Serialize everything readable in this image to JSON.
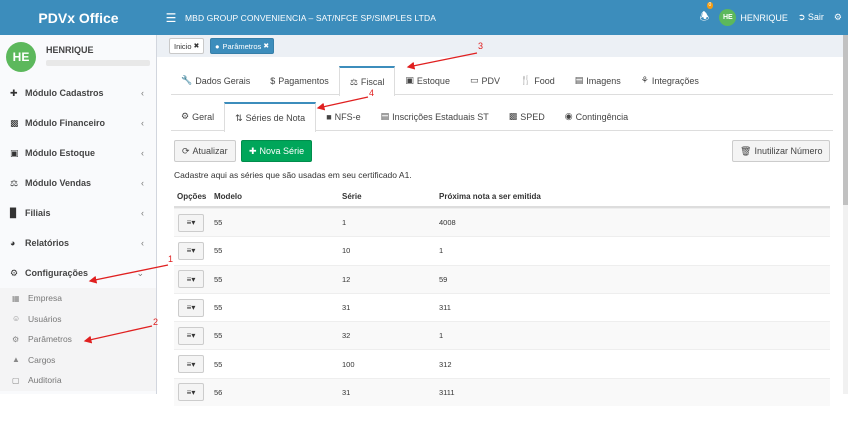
{
  "app": {
    "brand": "PDVx Office"
  },
  "header": {
    "company": "MBD GROUP CONVENIENCIA – SAT/NFCE SP/SIMPLES LTDA",
    "notification_count": "0",
    "avatar_initials": "HE",
    "user_name": "HENRIQUE",
    "logout_label": "Sair"
  },
  "sidebar": {
    "avatar_initials": "HE",
    "user_name": "HENRIQUE",
    "items": [
      {
        "label": "Módulo Cadastros",
        "icon": "plus-icon"
      },
      {
        "label": "Módulo Financeiro",
        "icon": "money-icon"
      },
      {
        "label": "Módulo Estoque",
        "icon": "box-icon"
      },
      {
        "label": "Módulo Vendas",
        "icon": "balance-icon"
      },
      {
        "label": "Filiais",
        "icon": "bar-chart-icon"
      },
      {
        "label": "Relatórios",
        "icon": "pie-chart-icon"
      },
      {
        "label": "Configurações",
        "icon": "gears-icon"
      }
    ],
    "subitems": [
      {
        "label": "Empresa",
        "icon": "building-icon"
      },
      {
        "label": "Usuários",
        "icon": "user-icon"
      },
      {
        "label": "Parâmetros",
        "icon": "gear-icon"
      },
      {
        "label": "Cargos",
        "icon": "sitemap-icon"
      },
      {
        "label": "Auditoria",
        "icon": "audit-icon"
      }
    ]
  },
  "breadcrumbs": [
    {
      "label": "Inicio"
    },
    {
      "label": "Parâmetros"
    }
  ],
  "main_tabs": [
    {
      "label": "Dados Gerais"
    },
    {
      "label": "Pagamentos"
    },
    {
      "label": "Fiscal"
    },
    {
      "label": "Estoque"
    },
    {
      "label": "PDV"
    },
    {
      "label": "Food"
    },
    {
      "label": "Imagens"
    },
    {
      "label": "Integrações"
    }
  ],
  "fiscal_tabs": [
    {
      "label": "Geral"
    },
    {
      "label": "Séries de Nota"
    },
    {
      "label": "NFS-e"
    },
    {
      "label": "Inscrições Estaduais ST"
    },
    {
      "label": "SPED"
    },
    {
      "label": "Contingência"
    }
  ],
  "toolbar": {
    "refresh_label": "Atualizar",
    "new_label": "Nova Série",
    "invalidate_label": "Inutilizar Número"
  },
  "description": "Cadastre aqui as séries que são usadas em seu certificado A1.",
  "table": {
    "headers": [
      "Opções",
      "Modelo",
      "Série",
      "Próxima nota a ser emitida"
    ],
    "rows": [
      [
        "55",
        "1",
        "4008"
      ],
      [
        "55",
        "10",
        "1"
      ],
      [
        "55",
        "12",
        "59"
      ],
      [
        "55",
        "31",
        "311"
      ],
      [
        "55",
        "32",
        "1"
      ],
      [
        "55",
        "100",
        "312"
      ],
      [
        "56",
        "31",
        "3111"
      ]
    ]
  },
  "annotations": [
    "1",
    "2",
    "3",
    "4"
  ],
  "colors": {
    "primary": "#3c8dbc",
    "success": "#00a65a",
    "annotation": "#e02020"
  }
}
